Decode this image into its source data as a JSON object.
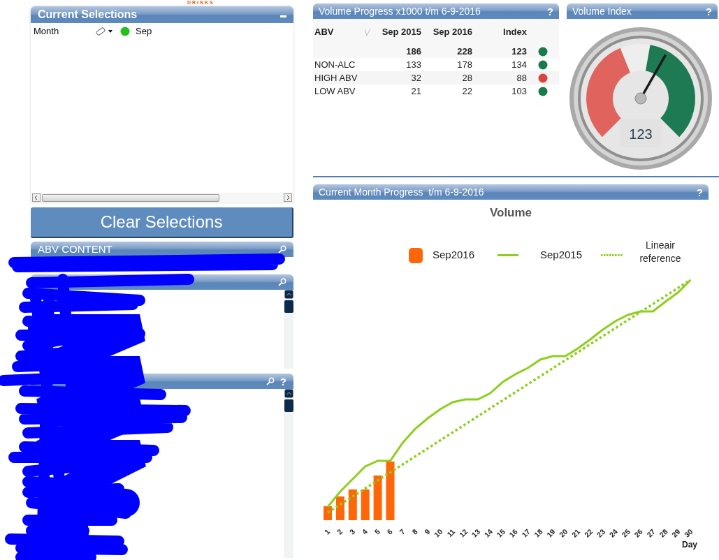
{
  "logo": {
    "text": "D R I N K S"
  },
  "current_selections": {
    "title": "Current Selections",
    "rows": [
      {
        "field": "Month",
        "value": "Sep",
        "color": "#22c01e"
      }
    ]
  },
  "clear_button": {
    "label": "Clear Selections"
  },
  "list_boxes": [
    {
      "title": "ABV CONTENT",
      "scrollbar": false
    },
    {
      "scrollbar": true
    },
    {
      "scrollbar": true,
      "help": "?"
    }
  ],
  "volume_progress": {
    "title": "Volume Progress x1000 t/m 6-9-2016",
    "help": "?",
    "columns": [
      "ABV",
      "Sep 2015",
      "Sep 2016",
      "Index"
    ],
    "total": {
      "values": [
        "186",
        "228",
        "123"
      ],
      "color": "#1a7a4c"
    },
    "rows": [
      {
        "label": "NON-ALC",
        "values": [
          "133",
          "178",
          "134"
        ],
        "color": "#1a7a4c"
      },
      {
        "label": "HIGH ABV",
        "values": [
          "32",
          "28",
          "88"
        ],
        "color": "#d9453c"
      },
      {
        "label": "LOW ABV",
        "values": [
          "21",
          "22",
          "103"
        ],
        "color": "#1a7a4c"
      }
    ]
  },
  "volume_index": {
    "title": "Volume Index",
    "help": "?",
    "reading": "123",
    "level": 0.61
  },
  "month_progress": {
    "title": "Current Month Progress  t/m 6-9-2016",
    "help": "?",
    "chart_title": "Volume",
    "legend": [
      {
        "kind": "bar",
        "label": "Sep2016",
        "color": "#ff6608"
      },
      {
        "kind": "line",
        "label": "Sep2015",
        "color": "#8ccf1c"
      },
      {
        "kind": "dotted",
        "label": "Lineair reference",
        "color": "#8ccf1c"
      }
    ],
    "x_labels": [
      "1",
      "2",
      "3",
      "4",
      "5",
      "6",
      "7",
      "8",
      "9",
      "10",
      "11",
      "12",
      "13",
      "14",
      "15",
      "16",
      "17",
      "18",
      "19",
      "20",
      "21",
      "22",
      "23",
      "24",
      "25",
      "26",
      "27",
      "28",
      "29",
      "30"
    ],
    "x_title": "Day"
  }
}
